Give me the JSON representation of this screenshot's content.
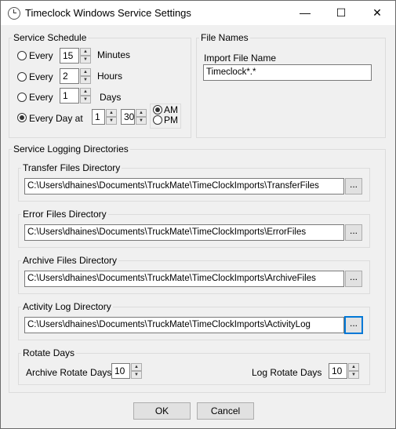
{
  "window": {
    "title": "Timeclock Windows Service Settings",
    "app_icon": "clock-icon",
    "minimize": "—",
    "maximize": "☐",
    "close": "✕"
  },
  "schedule": {
    "group_label": "Service Schedule",
    "every_minutes": {
      "label": "Every",
      "value": "15",
      "unit": "Minutes",
      "selected": false
    },
    "every_hours": {
      "label": "Every",
      "value": "2",
      "unit": "Hours",
      "selected": false
    },
    "every_days": {
      "label": "Every",
      "value": "1",
      "unit": "Days",
      "selected": false
    },
    "every_day_at": {
      "label": "Every Day at",
      "hour": "1",
      "minute": "30",
      "selected": true
    },
    "am_label": "AM",
    "pm_label": "PM",
    "ampm_selected": "AM"
  },
  "file_names": {
    "group_label": "File Names",
    "import_label": "Import File Name",
    "import_value": "Timeclock*.*"
  },
  "logging": {
    "group_label": "Service Logging Directories",
    "transfer": {
      "label": "Transfer Files Directory",
      "path": "C:\\Users\\dhaines\\Documents\\TruckMate\\TimeClockImports\\TransferFiles",
      "browse": "..."
    },
    "error": {
      "label": "Error Files Directory",
      "path": "C:\\Users\\dhaines\\Documents\\TruckMate\\TimeClockImports\\ErrorFiles",
      "browse": "..."
    },
    "archive": {
      "label": "Archive Files Directory",
      "path": "C:\\Users\\dhaines\\Documents\\TruckMate\\TimeClockImports\\ArchiveFiles",
      "browse": "..."
    },
    "activity": {
      "label": "Activity Log Directory",
      "path": "C:\\Users\\dhaines\\Documents\\TruckMate\\TimeClockImports\\ActivityLog",
      "browse": "..."
    },
    "rotate": {
      "group_label": "Rotate Days",
      "archive_label": "Archive Rotate Days",
      "archive_value": "10",
      "log_label": "Log Rotate Days",
      "log_value": "10"
    }
  },
  "buttons": {
    "ok": "OK",
    "cancel": "Cancel"
  },
  "colors": {
    "focus": "#0078d7"
  }
}
